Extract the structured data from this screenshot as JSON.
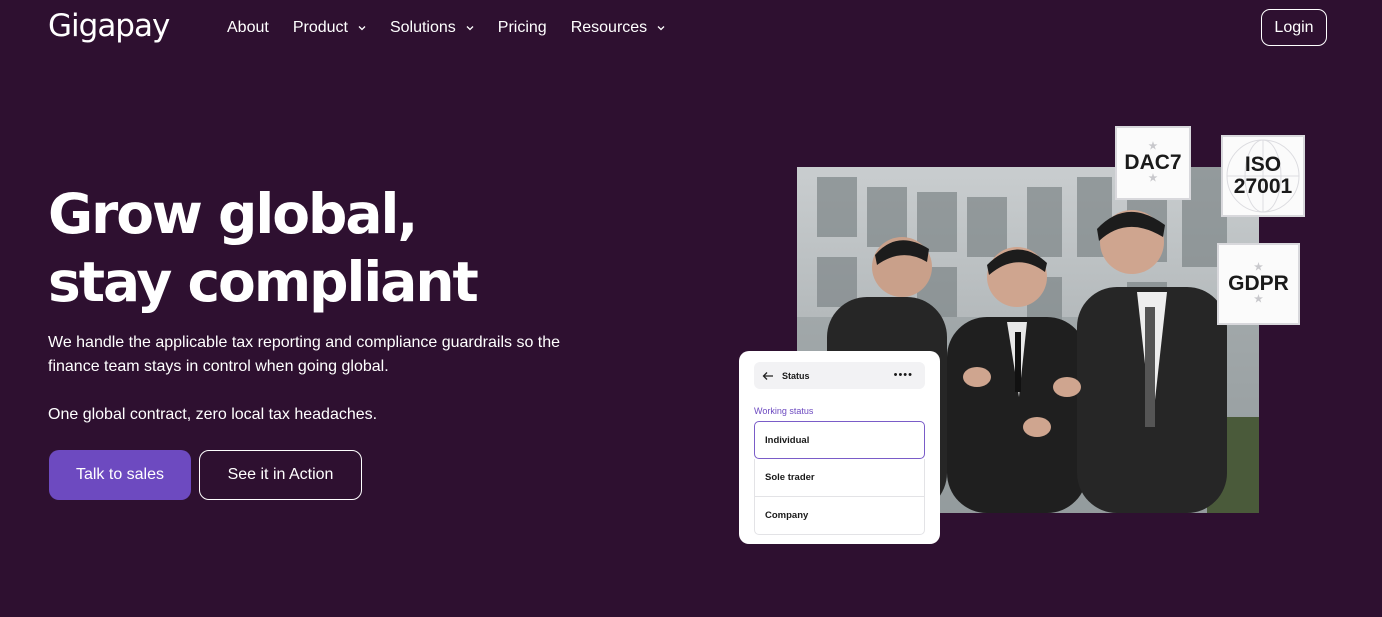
{
  "brand": {
    "logo_text": "Gigapay"
  },
  "nav": {
    "items": [
      {
        "label": "About",
        "has_dropdown": false
      },
      {
        "label": "Product",
        "has_dropdown": true
      },
      {
        "label": "Solutions",
        "has_dropdown": true
      },
      {
        "label": "Pricing",
        "has_dropdown": false
      },
      {
        "label": "Resources",
        "has_dropdown": true
      }
    ],
    "login_label": "Login"
  },
  "hero": {
    "headline_line1": "Grow global,",
    "headline_line2": "stay compliant",
    "subtitle": "We handle the applicable tax reporting and compliance guardrails so the finance team stays in control when going global.",
    "tagline": "One global contract, zero local tax headaches.",
    "primary_cta": "Talk to sales",
    "secondary_cta": "See it in Action"
  },
  "badges": {
    "dac7": "DAC7",
    "iso_line1": "ISO",
    "iso_line2": "27001",
    "gdpr": "GDPR"
  },
  "status_card": {
    "title": "Status",
    "more_icon": "more-dots-icon",
    "back_icon": "arrow-left-icon",
    "field_label": "Working status",
    "options": [
      "Individual",
      "Sole trader",
      "Company"
    ],
    "selected": "Individual"
  },
  "colors": {
    "background": "#2e1030",
    "accent": "#6d4ac0",
    "text": "#ffffff"
  }
}
